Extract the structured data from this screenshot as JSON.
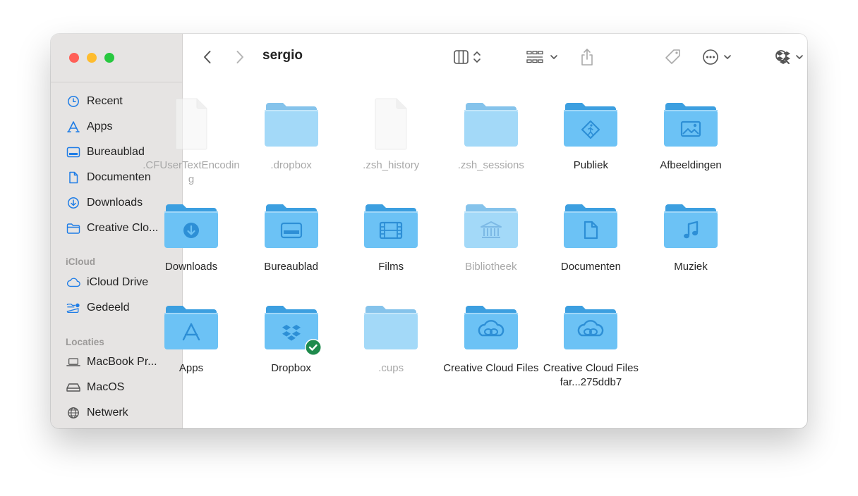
{
  "window": {
    "title": "sergio"
  },
  "sidebar": {
    "favorites": [
      {
        "label": "Recent",
        "icon": "clock-icon"
      },
      {
        "label": "Apps",
        "icon": "apps-icon"
      },
      {
        "label": "Bureaublad",
        "icon": "desktop-icon"
      },
      {
        "label": "Documenten",
        "icon": "document-icon"
      },
      {
        "label": "Downloads",
        "icon": "download-icon"
      },
      {
        "label": "Creative Clo...",
        "icon": "folder-icon"
      }
    ],
    "icloud_header": "iCloud",
    "icloud": [
      {
        "label": "iCloud Drive",
        "icon": "cloud-icon"
      },
      {
        "label": "Gedeeld",
        "icon": "shared-folder-icon"
      }
    ],
    "locations_header": "Locaties",
    "locations": [
      {
        "label": "MacBook Pr...",
        "icon": "laptop-icon"
      },
      {
        "label": "MacOS",
        "icon": "drive-icon"
      },
      {
        "label": "Netwerk",
        "icon": "network-icon"
      }
    ]
  },
  "items": [
    {
      "label": ".CFUserTextEncoding",
      "kind": "file",
      "hidden": true
    },
    {
      "label": ".dropbox",
      "kind": "folder",
      "hidden": true
    },
    {
      "label": ".zsh_history",
      "kind": "file",
      "hidden": true
    },
    {
      "label": ".zsh_sessions",
      "kind": "folder",
      "hidden": true
    },
    {
      "label": "Publiek",
      "kind": "folder",
      "glyph": "public"
    },
    {
      "label": "Afbeeldingen",
      "kind": "folder",
      "glyph": "image"
    },
    {
      "label": "Downloads",
      "kind": "folder",
      "glyph": "download"
    },
    {
      "label": "Bureaublad",
      "kind": "folder",
      "glyph": "desktop"
    },
    {
      "label": "Films",
      "kind": "folder",
      "glyph": "film"
    },
    {
      "label": "Bibliotheek",
      "kind": "folder",
      "glyph": "library",
      "hidden": true
    },
    {
      "label": "Documenten",
      "kind": "folder",
      "glyph": "document"
    },
    {
      "label": "Muziek",
      "kind": "folder",
      "glyph": "music"
    },
    {
      "label": "Apps",
      "kind": "folder",
      "glyph": "apps"
    },
    {
      "label": "Dropbox",
      "kind": "folder",
      "glyph": "dropbox",
      "badge": "synced"
    },
    {
      "label": ".cups",
      "kind": "folder",
      "hidden": true
    },
    {
      "label": "Creative Cloud Files",
      "kind": "folder",
      "glyph": "cc"
    },
    {
      "label": "Creative Cloud Files far...275ddb7",
      "kind": "folder",
      "glyph": "cc"
    }
  ],
  "colors": {
    "folder_front": "#6cc2f5",
    "folder_back": "#3c9fe0",
    "glyph": "#2d8fd6",
    "badge": "#1e8a4c"
  }
}
